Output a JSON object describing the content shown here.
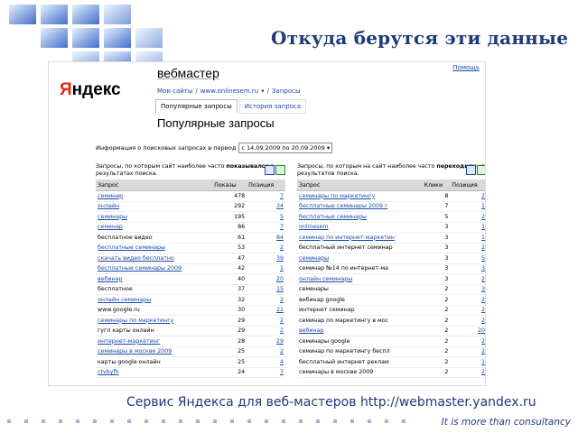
{
  "slide": {
    "title": "Откуда берутся эти данные",
    "caption": "Сервис Яндекса для веб-мастеров http://webmaster.yandex.ru",
    "tagline": "It is more than consultancy"
  },
  "screen": {
    "logo_first": "Я",
    "logo_rest": "ндекс",
    "service": "вебмастер",
    "help": "Помощь",
    "breadcrumb": [
      "Мои сайты",
      "/",
      "www.onlinesem.ru",
      "▾",
      "/",
      "Запросы"
    ],
    "tabs": [
      "Популярные запросы",
      "История запроса"
    ],
    "heading": "Популярные запросы",
    "period_label": "Информация о поисковых запросах в период",
    "period_value": "с 14.09.2009 по 20.09.2009",
    "left": {
      "desc_a": "Запросы, по которым сайт наиболее часто ",
      "desc_b": "показывался",
      "desc_c": " в результатах поиска.",
      "headers": [
        "Запрос",
        "Показы",
        "Позиция"
      ],
      "rows": [
        [
          "семинар",
          "478",
          "7"
        ],
        [
          "онлайн",
          "292",
          "34"
        ],
        [
          "семинары",
          "195",
          "5"
        ],
        [
          "семенар",
          "86",
          "7"
        ],
        [
          "бесплатное видео",
          "61",
          "84"
        ],
        [
          "бесплатные семинары",
          "53",
          "2"
        ],
        [
          "скачать видео бесплатно",
          "47",
          "39"
        ],
        [
          "бесплатные семинары 2009",
          "42",
          "1"
        ],
        [
          "вебинар",
          "40",
          "20"
        ],
        [
          "бесплатное",
          "37",
          "15"
        ],
        [
          "онлайн семинары",
          "32",
          "2"
        ],
        [
          "www.google.ru",
          "30",
          "21"
        ],
        [
          "семинары по маркетингу",
          "29",
          "2"
        ],
        [
          "гугл карты онлайн",
          "29",
          "2"
        ],
        [
          "интернет-маркетинг",
          "28",
          "29"
        ],
        [
          "семинары в москве 2009",
          "25",
          "2"
        ],
        [
          "карты google онлайн",
          "25",
          "4"
        ],
        [
          "ctvbyfh",
          "24",
          "7"
        ]
      ]
    },
    "right": {
      "desc_a": "Запросы, по которым на сайт наиболее часто ",
      "desc_b": "переходили",
      "desc_c": " из результатов поиска.",
      "headers": [
        "Запрос",
        "Клики",
        "Позиция"
      ],
      "rows": [
        [
          "семинары по маркетингу",
          "8",
          "2"
        ],
        [
          "бесплатные семинары 2009 г",
          "7",
          "1"
        ],
        [
          "бесплатные семинары",
          "5",
          "2"
        ],
        [
          "onlinesem",
          "3",
          "1"
        ],
        [
          "семинар по интернет-маркетин",
          "3",
          "1"
        ],
        [
          "бесплатный интернет семинар",
          "3",
          "2"
        ],
        [
          "семинары",
          "3",
          "5"
        ],
        [
          "семинар №14 по интернет-ма",
          "3",
          "3"
        ],
        [
          "онлайн семинары",
          "3",
          "2"
        ],
        [
          "семенары",
          "2",
          "3"
        ],
        [
          "вебинар google",
          "2",
          "2"
        ],
        [
          "интернет семинар",
          "2",
          "2"
        ],
        [
          "семинар по маркетингу в мос",
          "2",
          "2"
        ],
        [
          "вебинар",
          "2",
          "20"
        ],
        [
          "семинары google",
          "2",
          "2"
        ],
        [
          "семинар по маркетингу беспл",
          "2",
          "2"
        ],
        [
          "бесплатный интернет реклам",
          "2",
          "1"
        ],
        [
          "семинары в москве 2009",
          "2",
          "2"
        ]
      ],
      "link_rows": [
        0,
        1,
        2,
        3,
        4,
        6,
        8,
        13
      ]
    }
  },
  "colors": {
    "title": "#1f3a7a",
    "link": "#1a4aa8",
    "logo_red": "#e8231a"
  }
}
